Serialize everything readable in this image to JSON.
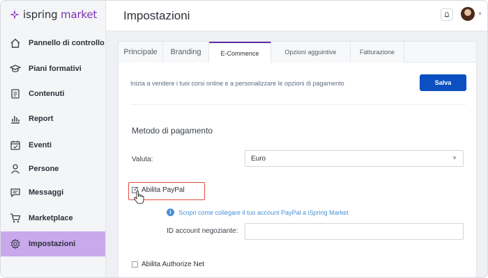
{
  "app": {
    "logo_text_prefix": "ispring",
    "logo_text_suffix": " market"
  },
  "sidebar": {
    "items": [
      {
        "label": "Pannello di controllo",
        "icon": "home-icon"
      },
      {
        "label": "Piani formativi",
        "icon": "graduation-cap-icon"
      },
      {
        "label": "Contenuti",
        "icon": "document-icon"
      },
      {
        "label": "Report",
        "icon": "bar-chart-icon"
      },
      {
        "label": "Eventi",
        "icon": "calendar-icon"
      },
      {
        "label": "Persone",
        "icon": "person-icon"
      },
      {
        "label": "Messaggi",
        "icon": "message-icon"
      },
      {
        "label": "Marketplace",
        "icon": "cart-icon"
      },
      {
        "label": "Impostazioni",
        "icon": "gear-icon",
        "active": true
      }
    ]
  },
  "header": {
    "title": "Impostazioni"
  },
  "tabs": [
    {
      "label": "Principale"
    },
    {
      "label": "Branding"
    },
    {
      "label": "E-Commence",
      "active": true
    },
    {
      "label": "Opzioni agguintive"
    },
    {
      "label": "Fatturazione"
    }
  ],
  "main": {
    "intro": "Inizia a vendere i tuoi corsi online e a personalizzare le opzioni di pagamento",
    "save_label": "Salva",
    "section_title": "Metodo di pagamento",
    "currency_label": "Valuta:",
    "currency_value": "Euro",
    "paypal_label": "Abilita PayPal",
    "paypal_checked": true,
    "paypal_help": "Scopri come collegare il tuo account PayPal a iSpring Market",
    "merchant_label": "ID account negoziante:",
    "merchant_value": "",
    "authorize_label": "Abilita Authorize Net",
    "authorize_checked": false
  },
  "colors": {
    "accent": "#5b2fa5",
    "active_nav": "#c9a8ec",
    "save_button": "#0b4fc0",
    "highlight_border": "#e04b3a",
    "link": "#4a90d9"
  }
}
